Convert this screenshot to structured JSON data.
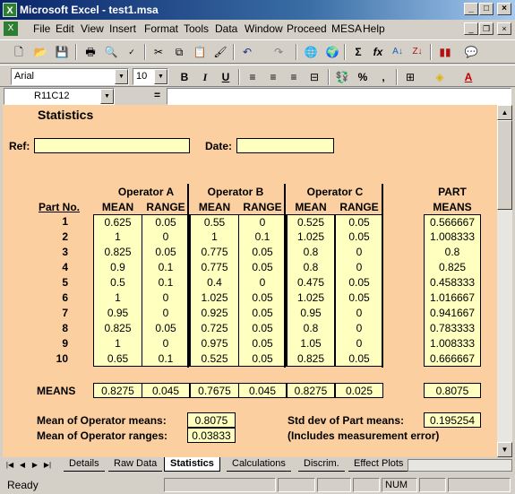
{
  "window": {
    "title": "Microsoft Excel - test1.msa",
    "min": "_",
    "max": "□",
    "close": "×"
  },
  "menu": [
    "File",
    "Edit",
    "View",
    "Insert",
    "Format",
    "Tools",
    "Data",
    "Window",
    "Proceed",
    "MESA",
    "Help"
  ],
  "font": {
    "name": "Arial",
    "size": "10"
  },
  "formula": {
    "name_box": "R11C12",
    "equals": "=",
    "content": ""
  },
  "sheet": {
    "title": "Statistics",
    "ref_label": "Ref:",
    "ref_value": "",
    "date_label": "Date:",
    "date_value": "",
    "part_no_header": "Part No.",
    "operators": [
      "Operator A",
      "Operator B",
      "Operator C"
    ],
    "mean_header": "MEAN",
    "range_header": "RANGE",
    "part_means_header": [
      "PART",
      "MEANS"
    ],
    "rows": [
      {
        "part": "1",
        "a": [
          "0.625",
          "0.05"
        ],
        "b": [
          "0.55",
          "0"
        ],
        "c": [
          "0.525",
          "0.05"
        ],
        "pm": "0.566667"
      },
      {
        "part": "2",
        "a": [
          "1",
          "0"
        ],
        "b": [
          "1",
          "0.1"
        ],
        "c": [
          "1.025",
          "0.05"
        ],
        "pm": "1.008333"
      },
      {
        "part": "3",
        "a": [
          "0.825",
          "0.05"
        ],
        "b": [
          "0.775",
          "0.05"
        ],
        "c": [
          "0.8",
          "0"
        ],
        "pm": "0.8"
      },
      {
        "part": "4",
        "a": [
          "0.9",
          "0.1"
        ],
        "b": [
          "0.775",
          "0.05"
        ],
        "c": [
          "0.8",
          "0"
        ],
        "pm": "0.825"
      },
      {
        "part": "5",
        "a": [
          "0.5",
          "0.1"
        ],
        "b": [
          "0.4",
          "0"
        ],
        "c": [
          "0.475",
          "0.05"
        ],
        "pm": "0.458333"
      },
      {
        "part": "6",
        "a": [
          "1",
          "0"
        ],
        "b": [
          "1.025",
          "0.05"
        ],
        "c": [
          "1.025",
          "0.05"
        ],
        "pm": "1.016667"
      },
      {
        "part": "7",
        "a": [
          "0.95",
          "0"
        ],
        "b": [
          "0.925",
          "0.05"
        ],
        "c": [
          "0.95",
          "0"
        ],
        "pm": "0.941667"
      },
      {
        "part": "8",
        "a": [
          "0.825",
          "0.05"
        ],
        "b": [
          "0.725",
          "0.05"
        ],
        "c": [
          "0.8",
          "0"
        ],
        "pm": "0.783333"
      },
      {
        "part": "9",
        "a": [
          "1",
          "0"
        ],
        "b": [
          "0.975",
          "0.05"
        ],
        "c": [
          "1.05",
          "0"
        ],
        "pm": "1.008333"
      },
      {
        "part": "10",
        "a": [
          "0.65",
          "0.1"
        ],
        "b": [
          "0.525",
          "0.05"
        ],
        "c": [
          "0.825",
          "0.05"
        ],
        "pm": "0.666667"
      }
    ],
    "means_label": "MEANS",
    "means": [
      "0.8275",
      "0.045",
      "0.7675",
      "0.045",
      "0.8275",
      "0.025"
    ],
    "overall_mean": "0.8075",
    "mean_op_means_label": "Mean of Operator means:",
    "mean_op_means": "0.8075",
    "mean_op_ranges_label": "Mean of Operator ranges:",
    "mean_op_ranges": "0.03833",
    "std_label": "Std dev of Part means:",
    "std_value": "0.195254",
    "note": "(Includes measurement error)"
  },
  "tabs": [
    "Details",
    "Raw Data",
    "Statistics",
    "Calculations",
    "Discrim.",
    "Effect Plots"
  ],
  "active_tab": "Statistics",
  "status": {
    "ready": "Ready",
    "num": "NUM"
  },
  "colors": {
    "sheet_bg": "#fbcf9f",
    "input_bg": "#ffffc0",
    "title_bar": "#0a246a"
  }
}
